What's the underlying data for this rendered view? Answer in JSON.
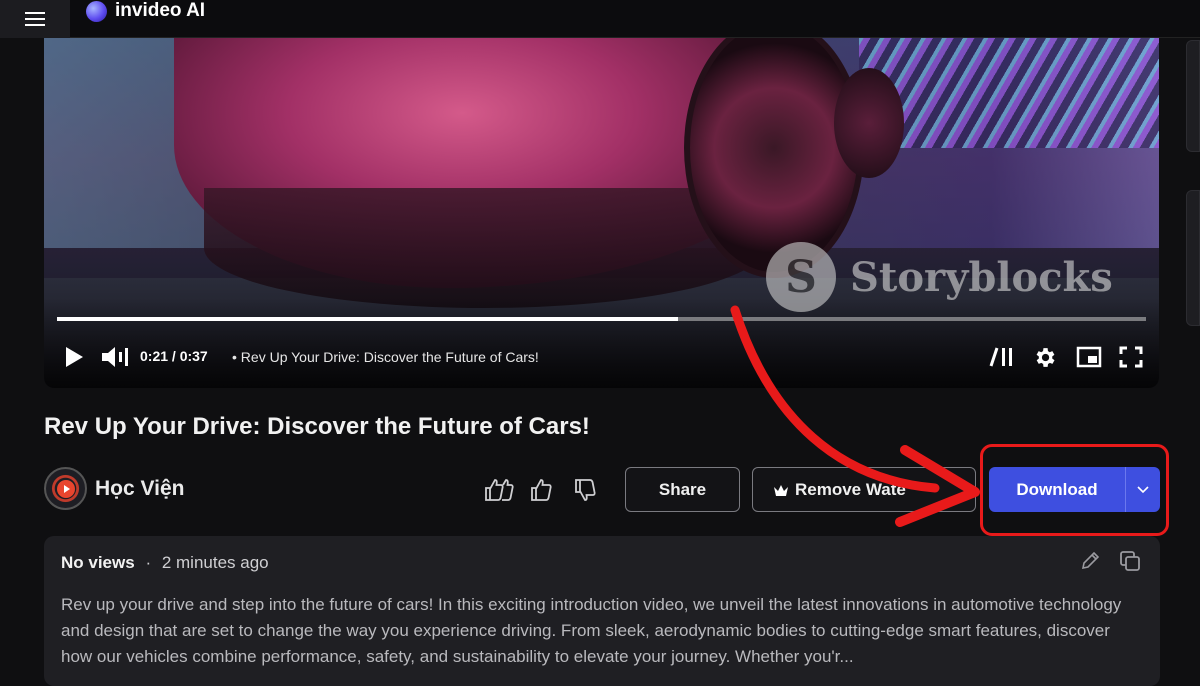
{
  "header": {
    "menu_icon": "hamburger-icon",
    "brand_name": "invideo AI"
  },
  "player": {
    "watermark": "Storyblocks",
    "current_time": "0:21",
    "duration": "0:37",
    "time_text": "0:21 / 0:37",
    "title_text": "• Rev Up Your Drive: Discover the Future of Cars!",
    "progress_fraction": 0.57,
    "controls": [
      "play-icon",
      "volume-icon",
      "chapters-icon",
      "settings-gear-icon",
      "miniplayer-icon",
      "fullscreen-icon"
    ]
  },
  "video": {
    "title": "Rev Up Your Drive: Discover the Future of Cars!",
    "channel_name": "Học Viện",
    "actions": {
      "share_label": "Share",
      "remove_watermark_label": "Remove Wate",
      "download_label": "Download"
    }
  },
  "description": {
    "views": "No views",
    "separator": "·",
    "age": "2 minutes ago",
    "text": "Rev up your drive and step into the future of cars! In this exciting introduction video, we unveil the latest innovations in automotive technology and design that are set to change the way you experience driving. From sleek, aerodynamic bodies to cutting-edge smart features, discover how our vehicles combine performance, safety, and sustainability to elevate your journey. Whether you'r..."
  },
  "colors": {
    "accent": "#3e4fe0",
    "annotation": "#e81a1a"
  }
}
